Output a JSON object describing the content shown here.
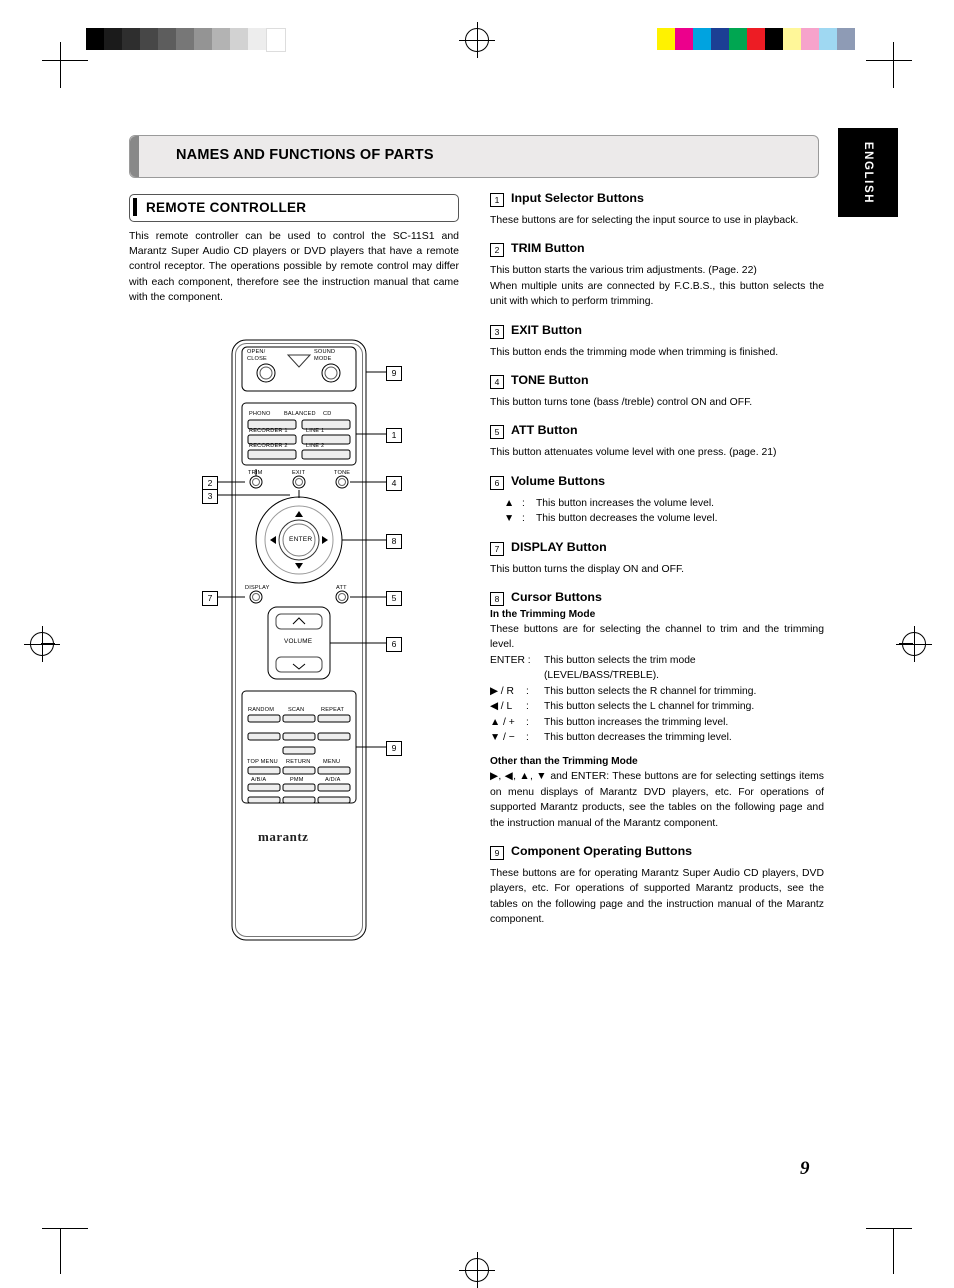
{
  "page": {
    "number": "9",
    "side_tab": "ENGLISH",
    "section_header": "NAMES AND FUNCTIONS OF PARTS"
  },
  "left": {
    "panel_title": "REMOTE CONTROLLER",
    "intro": "This remote controller can be used to control the SC-11S1 and Marantz Super Audio CD players or DVD players that have a remote control receptor. The operations possible by remote control may differ with each component, therefore see the instruction manual that came with the component."
  },
  "remote": {
    "brand": "marantz",
    "top_labels": {
      "open_close": "OPEN/\nCLOSE",
      "sound_mode": "SOUND\nMODE"
    },
    "input_row1": [
      "PHONO",
      "BALANCED",
      "CD"
    ],
    "input_row2": [
      "RECORDER 1",
      "LINE 1"
    ],
    "input_row3": [
      "RECORDER 2",
      "LINE 2"
    ],
    "fn_row": [
      "TRIM",
      "EXIT",
      "TONE"
    ],
    "mid_row": [
      "DISPLAY",
      "ATT"
    ],
    "volume_label": "VOLUME",
    "bottom_row1": [
      "RANDOM",
      "SCAN",
      "REPEAT"
    ],
    "bottom_row2": [
      "TOP MENU",
      "RETURN",
      "MENU"
    ],
    "bottom_row3": [
      "A/B/A",
      "PMM",
      "A/D/A"
    ],
    "enter_label": "ENTER",
    "callouts": [
      "1",
      "2",
      "3",
      "4",
      "5",
      "6",
      "7",
      "8",
      "9"
    ]
  },
  "items": [
    {
      "num": "1",
      "title": "Input Selector Buttons",
      "body": "These buttons are for selecting the input source to use in playback."
    },
    {
      "num": "2",
      "title": "TRIM Button",
      "body": "This button starts the various trim adjustments. (Page. 22)",
      "body2": "When multiple units are connected by F.C.B.S., this button selects the unit with which to perform trimming."
    },
    {
      "num": "3",
      "title": "EXIT Button",
      "body": "This button ends the trimming mode when trimming is finished."
    },
    {
      "num": "4",
      "title": "TONE Button",
      "body": "This button turns tone (bass /treble) control ON and OFF."
    },
    {
      "num": "5",
      "title": "ATT Button",
      "body": "This button attenuates volume level with one press. (page. 21)"
    },
    {
      "num": "6",
      "title": "Volume Buttons",
      "lines": [
        {
          "k": "▲",
          "sep": ":",
          "v": "This button increases the volume level."
        },
        {
          "k": "▼",
          "sep": ":",
          "v": "This button decreases the volume level."
        }
      ]
    },
    {
      "num": "7",
      "title": "DISPLAY Button",
      "body": "This button turns the display ON and OFF."
    },
    {
      "num": "8",
      "title": "Cursor Buttons",
      "sub1": "In the Trimming Mode",
      "body": "These buttons are for selecting the channel to trim and the trimming level.",
      "lines": [
        {
          "k": "ENTER :",
          "sep": "",
          "v": "This button selects the trim mode"
        },
        {
          "k": "",
          "sep": "",
          "v": "(LEVEL/BASS/TREBLE)."
        },
        {
          "k": "▶ / R",
          "sep": ":",
          "v": "This button selects the R channel for trimming."
        },
        {
          "k": "◀ / L",
          "sep": ":",
          "v": "This button selects the L channel for trimming."
        },
        {
          "k": "▲ / +",
          "sep": ":",
          "v": "This button increases the trimming level."
        },
        {
          "k": "▼ / −",
          "sep": ":",
          "v": "This button decreases the trimming level."
        }
      ],
      "sub2": "Other than the Trimming Mode",
      "body2": "▶, ◀, ▲, ▼ and ENTER: These buttons are for selecting settings items on menu displays of Marantz DVD players, etc. For operations of supported Marantz products, see the tables on the following page and the instruction manual of the Marantz component."
    },
    {
      "num": "9",
      "title": "Component Operating Buttons",
      "body": "These buttons are for operating Marantz Super Audio CD players, DVD players, etc. For operations of supported Marantz products, see the tables on the following page and the instruction manual of the Marantz component."
    }
  ],
  "colors": {
    "header_bg": "#eceaea",
    "header_border": "#9a9a9a",
    "tab_bg": "#000000",
    "text": "#000000"
  }
}
